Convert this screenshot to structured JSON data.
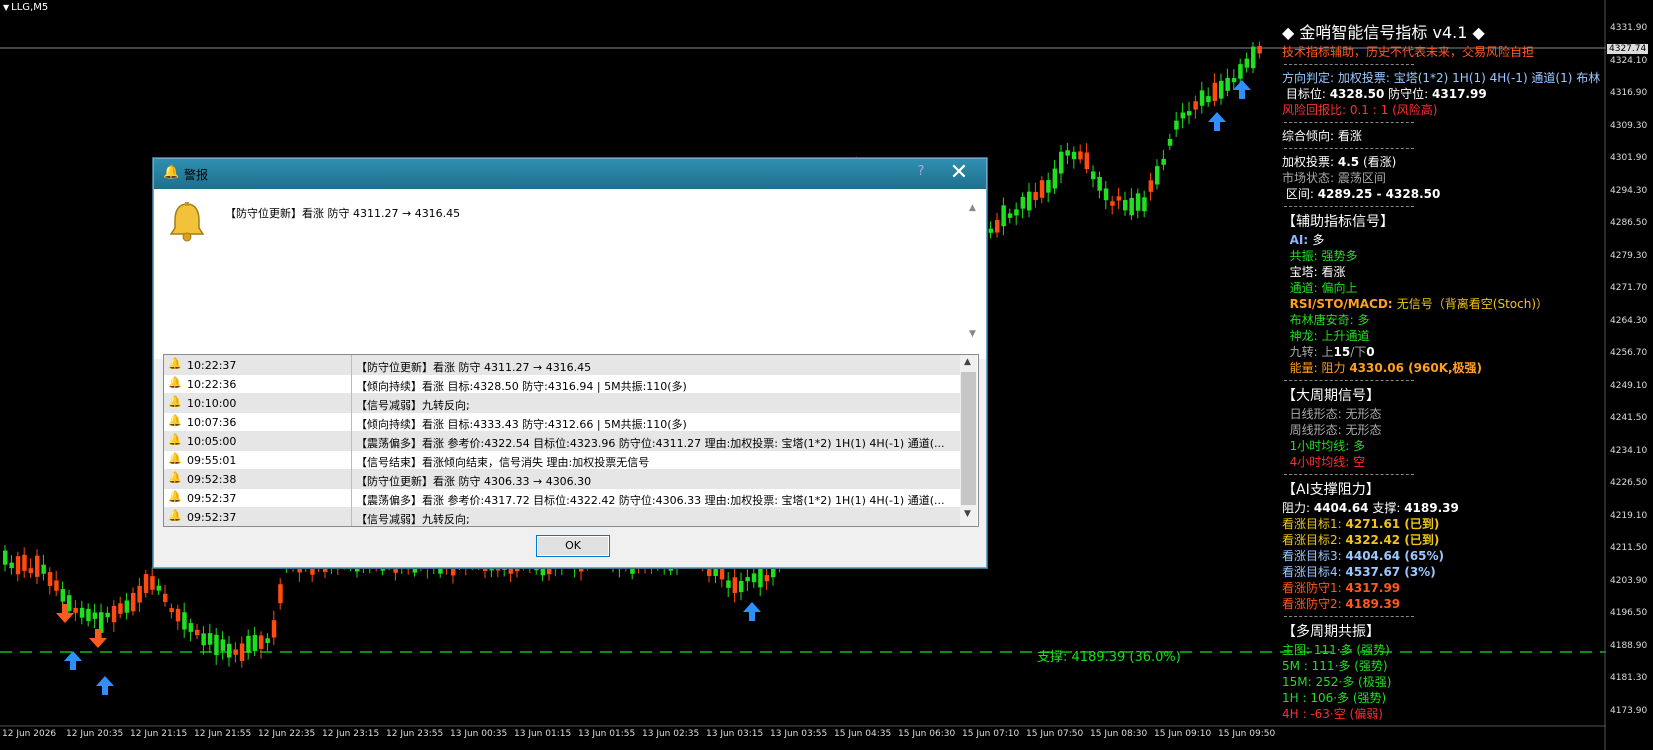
{
  "chart": {
    "symbol": "LLG,M5",
    "current_price": "4327.74",
    "support_label": "支撑: 4189.39 (36.0%)",
    "price_ticks": [
      "4331.90",
      "4324.10",
      "4316.90",
      "4309.30",
      "4301.90",
      "4294.30",
      "4286.50",
      "4279.30",
      "4271.70",
      "4264.30",
      "4256.70",
      "4249.10",
      "4241.50",
      "4234.10",
      "4226.50",
      "4219.10",
      "4211.50",
      "4203.90",
      "4196.50",
      "4188.90",
      "4181.30",
      "4173.90"
    ],
    "time_ticks": [
      "12 Jun 2026",
      "12 Jun 20:35",
      "12 Jun 21:15",
      "12 Jun 21:55",
      "12 Jun 22:35",
      "12 Jun 23:15",
      "12 Jun 23:55",
      "13 Jun 00:35",
      "13 Jun 01:15",
      "13 Jun 01:55",
      "13 Jun 02:35",
      "13 Jun 03:15",
      "13 Jun 03:55",
      "15 Jun 04:35",
      "15 Jun 06:30",
      "15 Jun 07:10",
      "15 Jun 07:50",
      "15 Jun 08:30",
      "15 Jun 09:10",
      "15 Jun 09:50"
    ],
    "colors": {
      "bull": "#1ee01e",
      "bear": "#ff4a10",
      "up_arrow": "#2f8fff",
      "down_arrow": "#ff5a1e",
      "support": "#19e019"
    }
  },
  "panel": {
    "title": "◆ 金哨智能信号指标 v4.1 ◆",
    "disclaimer": "技术指标辅助，历史不代表未来，交易风险自担",
    "direction_label": "方向判定: 加权投票: 宝塔(1*2) 1H(1) 4H(-1) 通道(1) 布林",
    "target_label": "目标位: ",
    "target_value": "4328.50",
    "defense_label": " 防守位: ",
    "defense_value": "4317.99",
    "risk": "风险回报比: 0.1 : 1 (风险高)",
    "tendency": "综合倾向: 看涨",
    "vote_label": "加权投票: ",
    "vote_value": "4.5",
    "vote_suffix": " (看涨)",
    "market_state": "市场状态: 震荡区间",
    "range_label": "区间: ",
    "range_value": "4289.25 - 4328.50",
    "aux_header": "【辅助指标信号】",
    "aux_ai_label": "AI: ",
    "aux_ai_value": "多",
    "aux_resonance": "共振: 强势多",
    "aux_tower": "宝塔: 看涨",
    "aux_channel": "通道: 偏向上",
    "aux_rsi_label": "RSI/STO/MACD: ",
    "aux_rsi_value": "无信号（背离看空(Stoch)）",
    "aux_bollinger": "布林唐安奇: 多",
    "aux_dragon": "神龙: 上升通道",
    "aux_nine_label": "九转: 上",
    "aux_nine_up": "15",
    "aux_nine_mid": "/下",
    "aux_nine_down": "0",
    "aux_energy_label": "能量: 阻力 ",
    "aux_energy_value": "4330.06 (960K,极强)",
    "big_header": "【大周期信号】",
    "big_daily": "日线形态: 无形态",
    "big_weekly": "周线形态: 无形态",
    "big_1h": "1小时均线: 多",
    "big_4h": "4小时均线: 空",
    "sr_header": "【AI支撑阻力】",
    "sr_res_label": "阻力: ",
    "sr_res_value": "4404.64",
    "sr_sup_label": "  支撑: ",
    "sr_sup_value": "4189.39",
    "sr_t1": "看涨目标1: ",
    "sr_t1_value": "4271.61 (已到)",
    "sr_t2": "看涨目标2: ",
    "sr_t2_value": "4322.42 (已到)",
    "sr_t3": "看涨目标3: ",
    "sr_t3_value": "4404.64 (65%)",
    "sr_t4": "看涨目标4: ",
    "sr_t4_value": "4537.67 (3%)",
    "sr_d1": "看涨防守1: ",
    "sr_d1_value": "4317.99",
    "sr_d2": "看涨防守2: ",
    "sr_d2_value": "4189.39",
    "mp_header": "【多周期共振】",
    "mp_main": "主图: 111·多 (强势)",
    "mp_5m": "5M : 111·多 (强势)",
    "mp_15m": "15M: 252·多 (极强)",
    "mp_1h": "1H : 106·多 (强势)",
    "mp_4h": "4H : -63·空 (偏弱)"
  },
  "dialog": {
    "title": "警报",
    "help": "?",
    "message": "【防守位更新】看涨 防守 4311.27 → 4316.45",
    "ok_label": "OK",
    "rows": [
      {
        "time": "10:22:37",
        "msg": "【防守位更新】看涨 防守 4311.27 → 4316.45"
      },
      {
        "time": "10:22:36",
        "msg": "【倾向持续】看涨 目标:4328.50 防守:4316.94 | 5M共振:110(多)"
      },
      {
        "time": "10:10:00",
        "msg": "【信号减弱】九转反向;"
      },
      {
        "time": "10:07:36",
        "msg": "【倾向持续】看涨 目标:4333.43 防守:4312.66 | 5M共振:110(多)"
      },
      {
        "time": "10:05:00",
        "msg": "【震荡偏多】看涨 参考价:4322.54 目标位:4323.96 防守位:4311.27 理由:加权投票: 宝塔(1*2) 1H(1) 4H(-1) 通道(..."
      },
      {
        "time": "09:55:01",
        "msg": "【信号结束】看涨倾向结束，信号消失 理由:加权投票无信号"
      },
      {
        "time": "09:52:38",
        "msg": "【防守位更新】看涨 防守 4306.33 → 4306.30"
      },
      {
        "time": "09:52:37",
        "msg": "【震荡偏多】看涨 参考价:4317.72 目标位:4322.42 防守位:4306.33 理由:加权投票: 宝塔(1*2) 1H(1) 4H(-1) 通道(..."
      },
      {
        "time": "09:52:37",
        "msg": "【信号减弱】九转反向;"
      }
    ]
  }
}
